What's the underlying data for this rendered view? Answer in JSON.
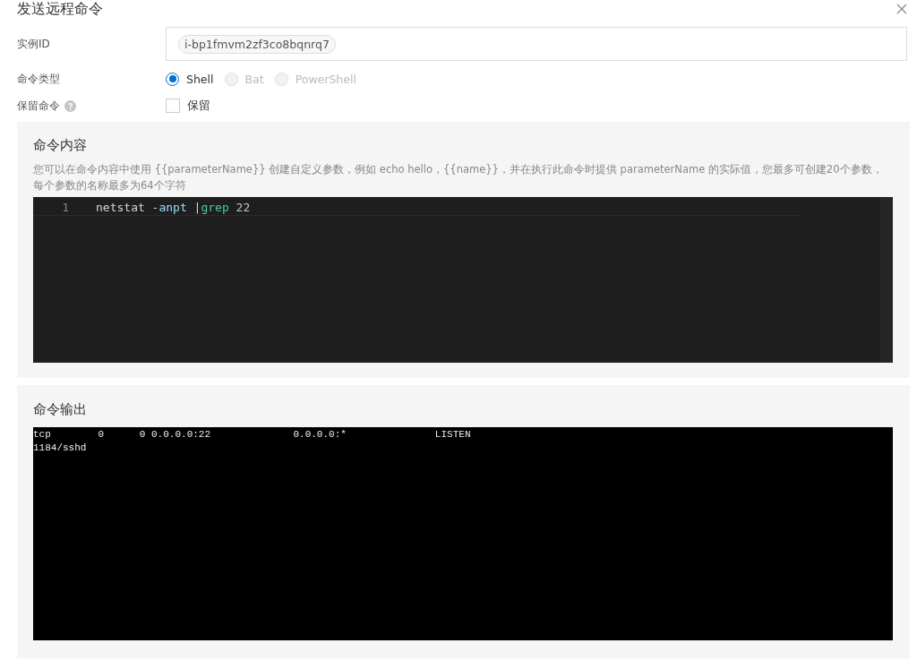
{
  "dialog": {
    "title": "发送远程命令"
  },
  "form": {
    "instance_label": "实例ID",
    "instance_tag": "i-bp1fmvm2zf3co8bqnrq7",
    "type_label": "命令类型",
    "types": [
      {
        "label": "Shell",
        "selected": true,
        "disabled": false
      },
      {
        "label": "Bat",
        "selected": false,
        "disabled": true
      },
      {
        "label": "PowerShell",
        "selected": false,
        "disabled": true
      }
    ],
    "keep_label": "保留命令",
    "keep_option": {
      "label": "保留",
      "checked": false
    }
  },
  "content": {
    "title": "命令内容",
    "hint": "您可以在命令内容中使用 {{parameterName}} 创建自定义参数，例如 echo hello，{{name}}，并在执行此命令时提供 parameterName 的实际值，您最多可创建20个参数，每个参数的名称最多为64个字符",
    "editor": {
      "lines": [
        {
          "number": "1",
          "tokens": [
            {
              "kind": "command",
              "text": "netstat"
            },
            {
              "kind": "option",
              "text": " -anpt "
            },
            {
              "kind": "plain",
              "text": "|"
            },
            {
              "kind": "builtin",
              "text": "grep"
            },
            {
              "kind": "number",
              "text": " 22"
            }
          ]
        }
      ]
    }
  },
  "output": {
    "title": "命令输出",
    "lines": [
      "tcp        0      0 0.0.0.0:22              0.0.0.0:*               LISTEN",
      "1184/sshd"
    ]
  }
}
